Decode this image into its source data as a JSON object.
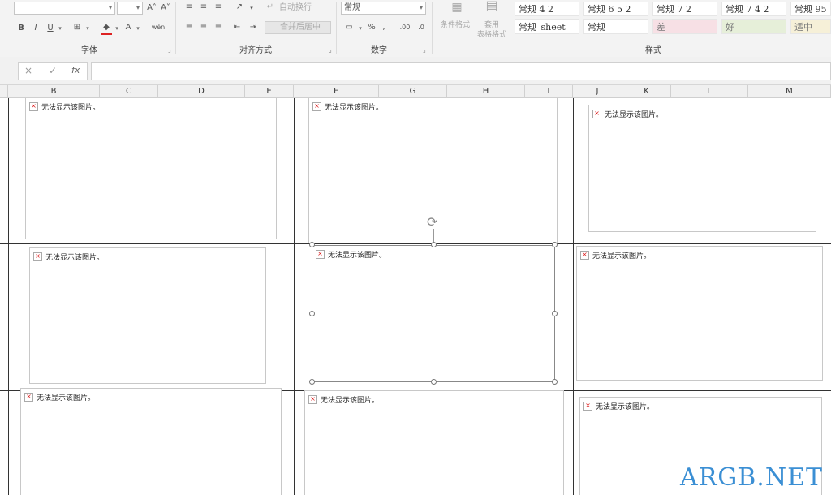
{
  "ribbon": {
    "font": {
      "label": "字体",
      "bold": "B",
      "italic": "I",
      "underline": "U",
      "grow_font": "A˄",
      "shrink_font": "A˅",
      "font_color": "A",
      "phonetic": "wén"
    },
    "alignment": {
      "label": "对齐方式",
      "wrap_text": "自动换行",
      "merge_center": "合并后居中"
    },
    "number": {
      "label": "数字",
      "format_value": "常规",
      "percent": "%",
      "comma": ","
    },
    "styles": {
      "label": "样式",
      "conditional_format": "条件格式",
      "table_format_line1": "套用",
      "table_format_line2": "表格格式",
      "cells_row1": [
        "常规 4 2",
        "常规 6 5 2",
        "常规 7 2",
        "常规 7 4 2",
        "常规 95"
      ],
      "cells_row2": [
        "常规_sheet",
        "常规",
        "差",
        "好",
        "适中"
      ]
    }
  },
  "formula_bar": {
    "cancel": "×",
    "enter": "✓",
    "fx": "fx",
    "value": ""
  },
  "columns": [
    "B",
    "C",
    "D",
    "E",
    "F",
    "G",
    "H",
    "I",
    "J",
    "K",
    "L",
    "M"
  ],
  "image_placeholders": [
    {
      "text": "无法显示该图片。"
    },
    {
      "text": "无法显示该图片。"
    },
    {
      "text": "无法显示该图片。"
    },
    {
      "text": "无法显示该图片。"
    },
    {
      "text": "无法显示该图片。"
    },
    {
      "text": "无法显示该图片。"
    },
    {
      "text": "无法显示该图片。"
    },
    {
      "text": "无法显示该图片。"
    },
    {
      "text": "无法显示该图片。"
    }
  ],
  "watermark": "ARGB.NET",
  "colors": {
    "ribbon_bg": "#f3f3f3",
    "watermark": "#3b8fd4",
    "grid_line": "#333333"
  }
}
